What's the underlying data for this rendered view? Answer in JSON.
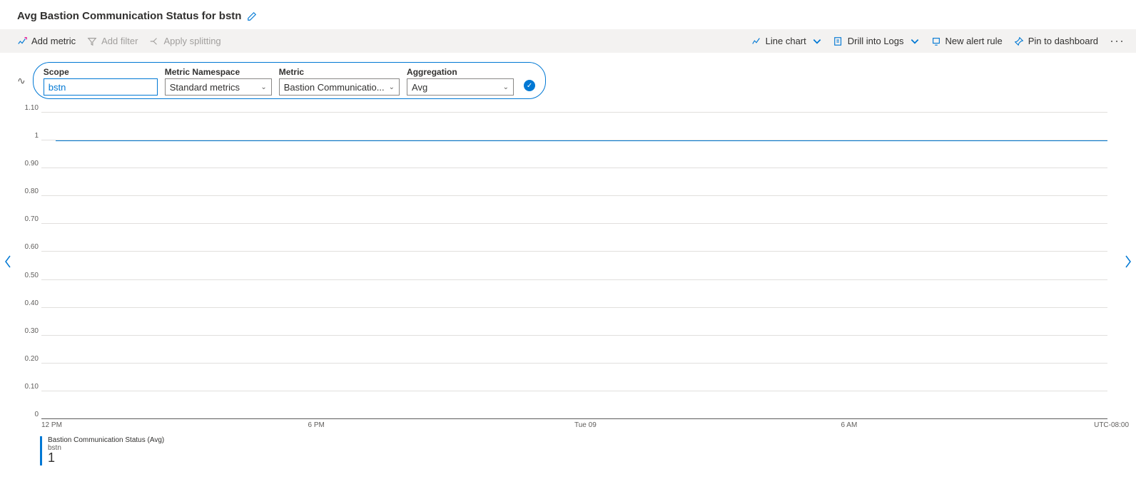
{
  "title": "Avg Bastion Communication Status for bstn",
  "toolbar": {
    "add_metric": "Add metric",
    "add_filter": "Add filter",
    "apply_splitting": "Apply splitting",
    "line_chart": "Line chart",
    "drill_logs": "Drill into Logs",
    "new_alert": "New alert rule",
    "pin_dashboard": "Pin to dashboard"
  },
  "pill": {
    "scope_label": "Scope",
    "scope_value": "bstn",
    "namespace_label": "Metric Namespace",
    "namespace_value": "Standard metrics",
    "metric_label": "Metric",
    "metric_value": "Bastion Communicatio...",
    "aggregation_label": "Aggregation",
    "aggregation_value": "Avg"
  },
  "legend": {
    "name": "Bastion Communication Status (Avg)",
    "resource": "bstn",
    "value": "1"
  },
  "timezone": "UTC-08:00",
  "chart_data": {
    "type": "line",
    "title": "Avg Bastion Communication Status for bstn",
    "ylabel": "",
    "xlabel": "",
    "ylim": [
      0,
      1.1
    ],
    "y_ticks": [
      "1.10",
      "1",
      "0.90",
      "0.80",
      "0.70",
      "0.60",
      "0.50",
      "0.40",
      "0.30",
      "0.20",
      "0.10",
      "0"
    ],
    "x_ticks": [
      "12 PM",
      "6 PM",
      "Tue 09",
      "6 AM"
    ],
    "series": [
      {
        "name": "Bastion Communication Status (Avg)",
        "color": "#0078d4",
        "x": [
          "12 PM",
          "6 PM",
          "Tue 09",
          "6 AM"
        ],
        "values": [
          1,
          1,
          1,
          1
        ]
      }
    ]
  }
}
